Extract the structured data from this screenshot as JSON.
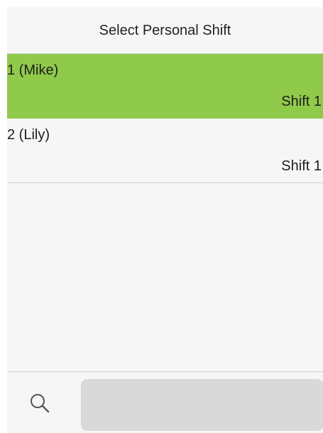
{
  "header": {
    "title": "Select Personal Shift"
  },
  "list": {
    "items": [
      {
        "name": "1 (Mike)",
        "shift": "Shift 1",
        "selected": true
      },
      {
        "name": "2 (Lily)",
        "shift": "Shift 1",
        "selected": false
      }
    ]
  },
  "footer": {
    "search_icon": "search-icon",
    "search_value": "",
    "search_placeholder": ""
  },
  "colors": {
    "selected_row": "#8fca4a",
    "background": "#f6f6f6",
    "search_field": "#d9d9d9"
  }
}
